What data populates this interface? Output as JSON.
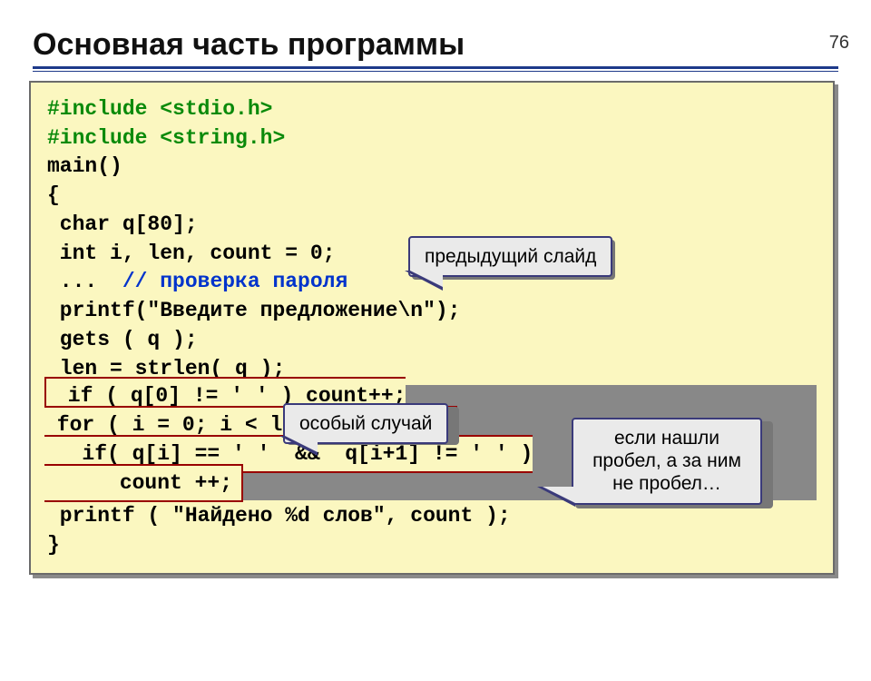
{
  "page_number": "76",
  "heading": "Основная часть программы",
  "code": {
    "l1a": "#include ",
    "l1b": "<stdio.h>",
    "l2a": "#include ",
    "l2b": "<string.h>",
    "l3": "main()",
    "l4": "{",
    "l5": " char q[80];",
    "l6": " int i, len, count = 0;",
    "l7a": " ...  ",
    "l7b": "// проверка пароля",
    "l8": " printf(\"Введите предложение\\n\");",
    "l9": " gets ( q );",
    "l10": " len = strlen( q );",
    "inner1": " if ( q[0] != ' ' ) count++;",
    "inner2": " for ( i = 0; i < len - 1; i ++ )",
    "inner3": "   if( q[i] == ' '  &&  q[i+1] != ' ' )",
    "inner4": "      count ++;",
    "l15": " printf ( \"Найдено %d слов\", count );",
    "l16": "}"
  },
  "callouts": {
    "prev_slide": "предыдущий слайд",
    "special_case": "особый случай",
    "if_found": "если нашли пробел, а за ним не пробел…"
  }
}
